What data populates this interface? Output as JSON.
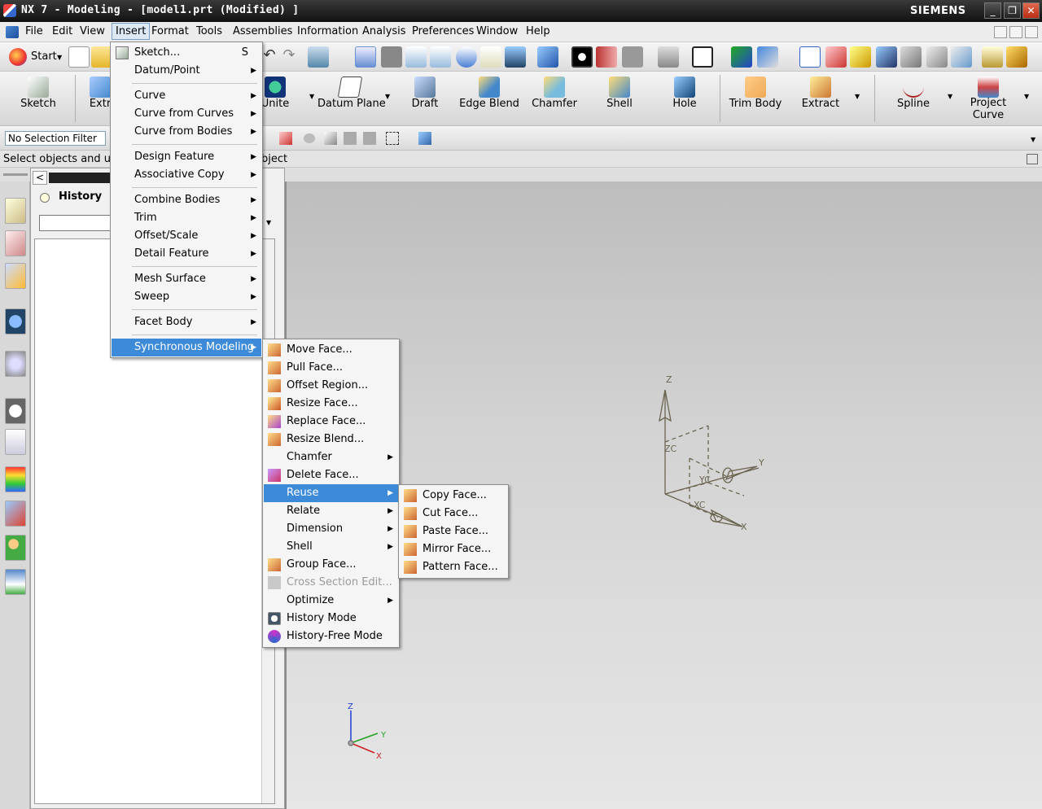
{
  "window": {
    "title": "NX 7 - Modeling - [model1.prt (Modified) ]",
    "brand": "SIEMENS",
    "minimize": "_",
    "restore": "❐",
    "close": "✕"
  },
  "menubar": {
    "items": [
      "File",
      "Edit",
      "View",
      "Insert",
      "Format",
      "Tools",
      "Assemblies",
      "Information",
      "Analysis",
      "Preferences",
      "Window",
      "Help"
    ],
    "active": "Insert"
  },
  "toolbar1": {
    "start_label": "Start"
  },
  "toolbar2": {
    "buttons": [
      "Sketch",
      "Extrude",
      "Unite",
      "Datum Plane",
      "Draft",
      "Edge Blend",
      "Chamfer",
      "Shell",
      "Hole",
      "Trim Body",
      "Extract",
      "Spline",
      "Project Curve"
    ],
    "extrude_visible": "Extr"
  },
  "selection": {
    "filter_value": "No Selection Filter"
  },
  "cue": {
    "text_left": "Select objects and u",
    "text_right": "bject"
  },
  "nav": {
    "title": "History",
    "collapse": "<"
  },
  "insert_menu": {
    "items": [
      {
        "label": "Sketch...",
        "key": "S"
      },
      {
        "label": "Datum/Point"
      },
      {
        "label": "Curve"
      },
      {
        "label": "Curve from Curves"
      },
      {
        "label": "Curve from Bodies"
      },
      {
        "label": "Design Feature"
      },
      {
        "label": "Associative Copy"
      },
      {
        "label": "Combine Bodies"
      },
      {
        "label": "Trim"
      },
      {
        "label": "Offset/Scale"
      },
      {
        "label": "Detail Feature"
      },
      {
        "label": "Mesh Surface"
      },
      {
        "label": "Sweep"
      },
      {
        "label": "Facet Body"
      },
      {
        "label": "Synchronous Modeling"
      }
    ],
    "highlighted": "Synchronous Modeling"
  },
  "sync_menu": {
    "items": [
      {
        "label": "Move Face..."
      },
      {
        "label": "Pull Face..."
      },
      {
        "label": "Offset Region..."
      },
      {
        "label": "Resize Face..."
      },
      {
        "label": "Replace Face..."
      },
      {
        "label": "Resize Blend..."
      },
      {
        "label": "Chamfer"
      },
      {
        "label": "Delete Face..."
      },
      {
        "label": "Reuse"
      },
      {
        "label": "Relate"
      },
      {
        "label": "Dimension"
      },
      {
        "label": "Shell"
      },
      {
        "label": "Group Face..."
      },
      {
        "label": "Cross Section Edit..."
      },
      {
        "label": "Optimize"
      },
      {
        "label": "History Mode"
      },
      {
        "label": "History-Free Mode"
      }
    ],
    "highlighted": "Reuse",
    "disabled": "Cross Section Edit..."
  },
  "reuse_menu": {
    "items": [
      {
        "label": "Copy Face..."
      },
      {
        "label": "Cut Face..."
      },
      {
        "label": "Paste Face..."
      },
      {
        "label": "Mirror Face..."
      },
      {
        "label": "Pattern Face..."
      }
    ]
  },
  "triad_main": {
    "z": "Z",
    "y": "Y",
    "x": "X",
    "zc": "ZC",
    "yc": "YC",
    "xc": "XC"
  },
  "triad_corner": {
    "z": "Z",
    "y": "Y",
    "x": "X"
  },
  "colors": {
    "menu_highlight": "#3c8ad8",
    "triad": "#6b6450",
    "axis_x": "#d02020",
    "axis_y": "#20a020",
    "axis_z": "#2040d0"
  }
}
